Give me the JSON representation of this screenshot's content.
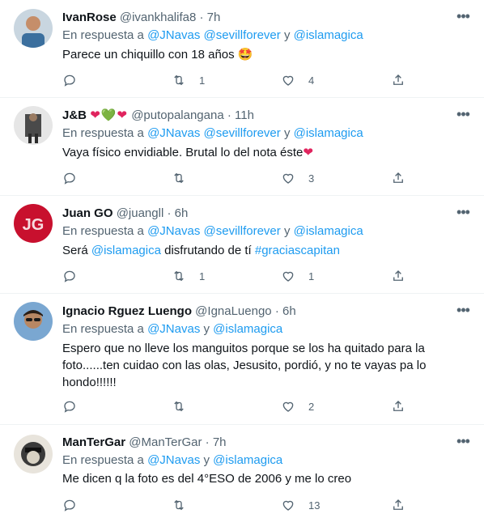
{
  "reply_prefix": "En respuesta a",
  "reply_conj": "y",
  "tweets": [
    {
      "name": "IvanRose",
      "handle": "@ivankhalifa8",
      "time": "7h",
      "mentions": [
        "@JNavas",
        "@sevillforever",
        "@islamagica"
      ],
      "text": "Parece un chiquillo con 18 años",
      "emoji": "🤩",
      "retweets": "1",
      "likes": "4"
    },
    {
      "name": "J&B",
      "name_emojis": "❤💚❤",
      "handle": "@putopalangana",
      "time": "11h",
      "mentions": [
        "@JNavas",
        "@sevillforever",
        "@islamagica"
      ],
      "text": "Vaya físico envidiable. Brutal lo del nota éste",
      "emoji": "❤",
      "retweets": "",
      "likes": "3"
    },
    {
      "name": "Juan GO",
      "handle": "@juangll",
      "time": "6h",
      "mentions": [
        "@JNavas",
        "@sevillforever",
        "@islamagica"
      ],
      "text_parts": [
        "Será ",
        "@islamagica",
        " disfrutando de tí ",
        "#graciascapitan"
      ],
      "retweets": "1",
      "likes": "1"
    },
    {
      "name": "Ignacio Rguez Luengo",
      "handle": "@IgnaLuengo",
      "time": "6h",
      "mentions": [
        "@JNavas",
        "@islamagica"
      ],
      "text_lines": [
        "Espero que no lleve los manguitos porque se los ha quitado para la",
        "foto......ten cuidao con las olas, Jesusito, pordió, y no te vayas pa lo",
        "hondo!!!!!!"
      ],
      "retweets": "",
      "likes": "2"
    },
    {
      "name": "ManTerGar",
      "handle": "@ManTerGar",
      "time": "7h",
      "mentions": [
        "@JNavas",
        "@islamagica"
      ],
      "text": "Me dicen q la foto es del 4°ESO de 2006 y me lo creo",
      "retweets": "",
      "likes": "13"
    }
  ],
  "icons": {
    "reply": "reply-icon",
    "retweet": "retweet-icon",
    "like": "like-icon",
    "share": "share-icon",
    "more": "more-icon"
  },
  "colors": {
    "link": "#1d9bf0",
    "muted": "#536471",
    "text": "#0f1419"
  }
}
